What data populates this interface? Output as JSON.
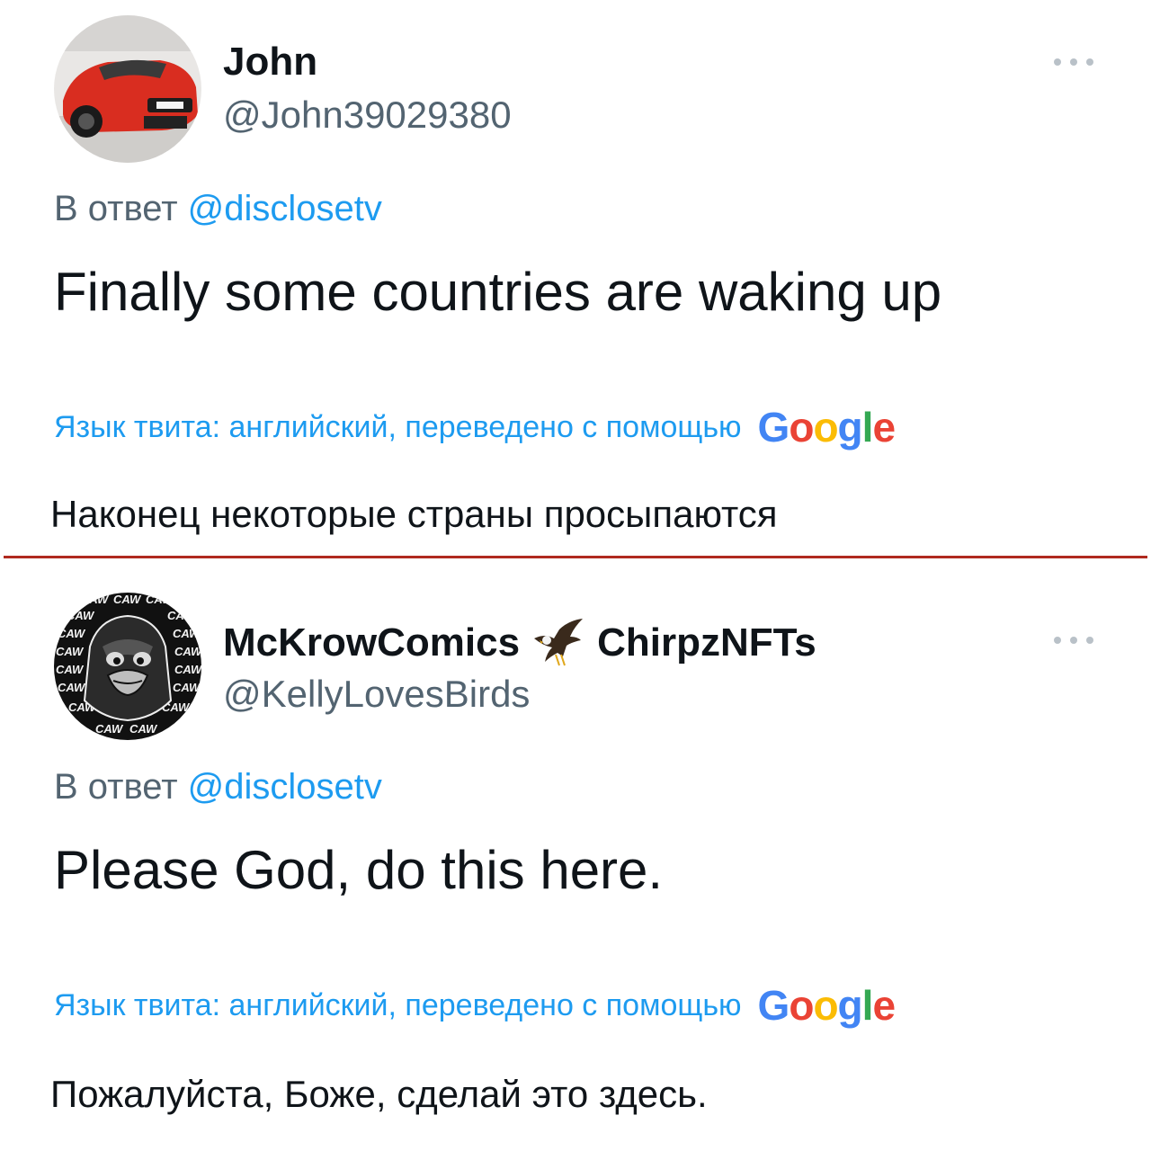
{
  "tweets": [
    {
      "name": "John",
      "handle": "@John39029380",
      "reply_prefix": "В ответ",
      "reply_mention": "@disclosetv",
      "text": "Finally some countries are waking up",
      "translated_label": "Язык твита: английский, переведено с помощью",
      "translation": "Наконец некоторые страны просыпаются"
    },
    {
      "name": "McKrowComics",
      "name_suffix": "ChirpzNFTs",
      "handle": "@KellyLovesBirds",
      "reply_prefix": "В ответ",
      "reply_mention": "@disclosetv",
      "text": "Please God, do this here.",
      "translated_label": "Язык твита: английский, переведено с помощью",
      "translation": "Пожалуйста, Боже, сделай это здесь."
    }
  ],
  "google_logo": {
    "letters": [
      "G",
      "o",
      "o",
      "g",
      "l",
      "e"
    ],
    "colors": [
      "#4285F4",
      "#EA4335",
      "#FBBC05",
      "#4285F4",
      "#34A853",
      "#EA4335"
    ]
  },
  "avatar2_pattern_text": "CAW",
  "colors": {
    "link": "#1d9bf0",
    "secondary": "#536471",
    "divider": "#b02a1f"
  }
}
